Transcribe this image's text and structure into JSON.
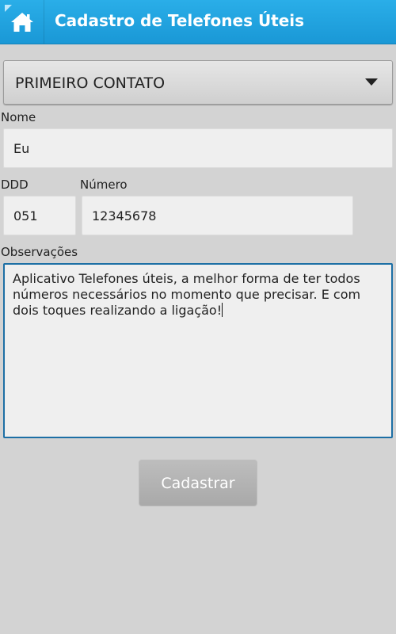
{
  "header": {
    "title": "Cadastro de Telefones Úteis",
    "home_icon": "home-icon"
  },
  "spinner": {
    "selected": "PRIMEIRO CONTATO",
    "arrow_icon": "dropdown-arrow-icon"
  },
  "form": {
    "name_label": "Nome",
    "name_value": "Eu",
    "ddd_label": "DDD",
    "ddd_value": "051",
    "number_label": "Número",
    "number_value": "12345678",
    "notes_label": "Observações",
    "notes_value": "Aplicativo Telefones úteis, a melhor forma de ter todos números necessários no momento que precisar. E com dois toques realizando a ligação!",
    "submit_label": "Cadastrar"
  },
  "colors": {
    "appbar": "#1ea3de",
    "background": "#d3d3d3",
    "focus_border": "#1d6fa5"
  }
}
